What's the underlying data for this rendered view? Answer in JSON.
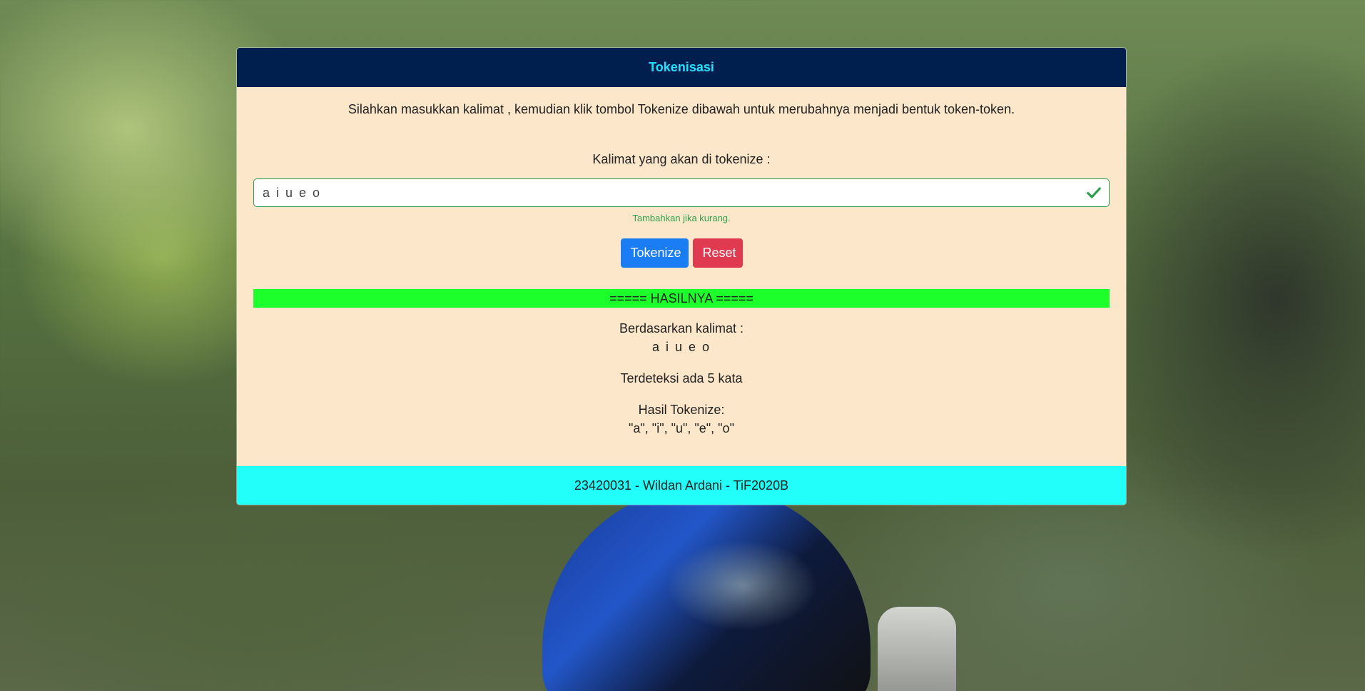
{
  "header": {
    "title": "Tokenisasi"
  },
  "intro": {
    "text": "Silahkan masukkan kalimat , kemudian klik tombol Tokenize dibawah untuk merubahnya menjadi bentuk token-token."
  },
  "form": {
    "label": "Kalimat yang akan di tokenize :",
    "input_value": "a i u e o",
    "help_text": "Tambahkan jika kurang.",
    "tokenize_label": "Tokenize",
    "reset_label": "Reset"
  },
  "result": {
    "banner": "===== HASILNYA =====",
    "based_on_label": "Berdasarkan kalimat :",
    "sentence": "a i u e o",
    "count_text": "Terdeteksi ada 5 kata",
    "tokens_label": "Hasil Tokenize:",
    "tokens": "\"a\", \"i\", \"u\", \"e\", \"o\""
  },
  "footer": {
    "text": "23420031 - Wildan Ardani - TiF2020B"
  },
  "colors": {
    "header_bg": "#011f4e",
    "header_text": "#22e2ff",
    "card_bg": "#fde7ca",
    "valid_green": "#2e9e4e",
    "primary": "#1a7df3",
    "danger": "#df3a4f",
    "result_bar": "#1dff2b",
    "footer_bg": "#22fffb"
  },
  "icons": {
    "input_valid": "check-icon"
  }
}
